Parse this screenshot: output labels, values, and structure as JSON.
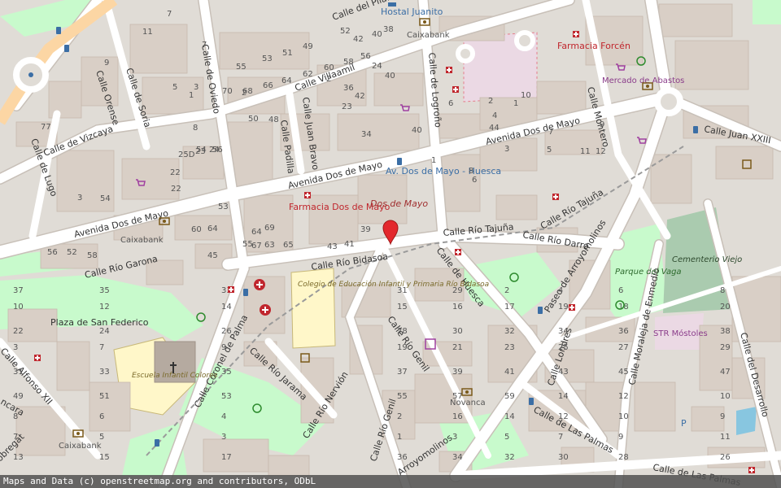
{
  "colors": {
    "background": "#e0dcd6",
    "road": "#ffffff",
    "road_casing": "#c8c0b8",
    "building": "#d9cfc6",
    "park": "#c8facc",
    "park_dark": "#add19e",
    "cemetery": "#aacbaf",
    "school": "#fff7c9",
    "pedestrian": "#ebd9e4",
    "primary": "#fcd6a4",
    "marker": "#e3282d"
  },
  "streets": {
    "avenida_dos_de_mayo_1": "Avenida Dos de Mayo",
    "avenida_dos_de_mayo_2": "Avenida Dos de Mayo",
    "avenida_dos_de_mayo_3": "Avenida Dos de Mayo",
    "calle_de_oviedo": "Calle de Oviedo",
    "calle_villaamil": "Calle Villaamil",
    "calle_del_pilar": "Calle del Pilar",
    "calle_de_logrono": "Calle de Logroño",
    "calle_de_soria": "Calle de Soria",
    "calle_orense": "Calle Orense",
    "calle_de_vizcaya": "Calle de Vizcaya",
    "calle_de_lugo": "Calle de Lugo",
    "calle_juan_bravo": "Calle Juan Bravo",
    "calle_padilla": "Calle Padilla",
    "calle_montero": "Calle Montero",
    "calle_juan_xxiii": "Calle Juan XXIII",
    "calle_rio_tajuna_1": "Calle Río Tajuña",
    "calle_rio_tajuna_2": "Calle Río Tajuña",
    "calle_rio_darro": "Calle Río Darro",
    "calle_rio_bidasoa": "Calle Río Bidasoa",
    "calle_rio_garona": "Calle Río Garona",
    "calle_de_huesca": "Calle de Huesca",
    "paseo_de_arroyomolinos": "Paseo de Arroyomolinos",
    "calle_rio_genil_1": "Calle Río Genil",
    "calle_rio_genil_2": "Calle Río Genil",
    "calle_rio_jarama": "Calle Río Jarama",
    "calle_rio_nervion": "Calle Río Nervión",
    "calle_coronel_de_palma": "Calle Coronel de Palma",
    "calle_alfonso_xii": "Calle Alfonso XII",
    "calle_londres": "Calle Londres",
    "calle_de_las_palmas_1": "Calle de Las Palmas",
    "calle_de_las_palmas_2": "Calle de Las Palmas",
    "calle_moraleja": "Calle Moraleja de Enmedio",
    "calle_del_desarrollo": "Calle del Desarrollo",
    "arroyomolinos_bottom": "Arroyomolinos",
    "ncara": "ncara",
    "obregat": "obregat"
  },
  "pois": {
    "hostal_juanito": "Hostal Juanito",
    "caixabank_top": "Caixabank",
    "caixabank_left": "Caixabank",
    "caixabank_bottom": "Caixabank",
    "farmacia_forcen": "Farmacia Forcén",
    "mercado_de_abastos": "Mercado de Abastos",
    "farmacia_dos_de_mayo": "Farmacia Dos de Mayo",
    "bus_dos_de_mayo_huesca": "Av. Dos de Mayo - Huesca",
    "dos_de_mayo_place": "Dos de Mayo",
    "plaza_san_federico": "Plaza de San Federico",
    "colegio_rio_bidasoa": "Colegio de Educación Infantil y Primaria Río Bidasoa",
    "escuela_infantil_colores": "Escuela Infantil Colores",
    "parque_del_vaga": "Parque del Vaga",
    "cementerio_viejo": "Cementerio Viejo",
    "str_mostoles": "STR Móstoles",
    "novanca": "Novanca"
  },
  "house_numbers": [
    "7",
    "11",
    "9",
    "3",
    "1",
    "5",
    "8",
    "7",
    "77",
    "55",
    "53",
    "51",
    "49",
    "48",
    "50",
    "52",
    "54",
    "56",
    "2",
    "70",
    "68",
    "66",
    "64",
    "62",
    "60",
    "58",
    "56",
    "2",
    "42",
    "40",
    "38",
    "36",
    "34",
    "42",
    "23",
    "24",
    "40",
    "40",
    "1",
    "6",
    "4",
    "2",
    "10",
    "8",
    "6",
    "44",
    "1",
    "3",
    "5",
    "7",
    "9",
    "11",
    "12",
    "25D",
    "23",
    "24",
    "22",
    "22",
    "3",
    "54",
    "56",
    "52",
    "58",
    "60",
    "64",
    "64",
    "69",
    "67",
    "65",
    "63",
    "55",
    "53",
    "45",
    "43",
    "41",
    "39",
    "37",
    "35",
    "33",
    "31",
    "29",
    "2",
    "4",
    "6",
    "8",
    "10",
    "12",
    "14",
    "15",
    "16",
    "17",
    "19",
    "18",
    "20",
    "22",
    "24",
    "26",
    "28",
    "30",
    "32",
    "34",
    "36",
    "38",
    "3",
    "7",
    "9",
    "19",
    "21",
    "23",
    "25",
    "27",
    "29",
    "31",
    "33",
    "35",
    "37",
    "39",
    "41",
    "43",
    "45",
    "47",
    "49",
    "51",
    "53",
    "55",
    "57",
    "59",
    "14",
    "12",
    "10",
    "8",
    "6",
    "4",
    "2",
    "16",
    "14",
    "12",
    "10",
    "9",
    "7",
    "5",
    "3",
    "1",
    "3",
    "5",
    "7",
    "9",
    "11",
    "13",
    "15",
    "17",
    "36",
    "34",
    "32",
    "30",
    "28",
    "26",
    "35",
    "33",
    "31",
    "29",
    "27",
    "25",
    "23",
    "21",
    "19",
    "17",
    "15",
    "13",
    "11",
    "9",
    "7",
    "5",
    "3",
    "1"
  ],
  "marker": {
    "label": "location-marker"
  },
  "attribution": "Maps and Data (c) openstreetmap.org and contributors, ODbL"
}
